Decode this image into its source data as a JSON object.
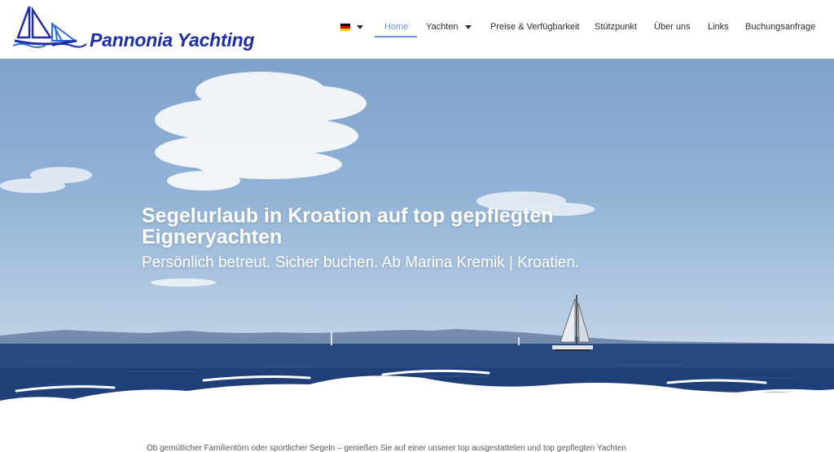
{
  "brand": {
    "name": "Pannonia Yachting",
    "color": "#1c2fa6"
  },
  "nav": {
    "language_icon": "german-flag-icon",
    "items": [
      {
        "label": "Home",
        "active": true
      },
      {
        "label": "Yachten",
        "has_dropdown": true
      },
      {
        "label": "Preise & Verfügbarkeit"
      },
      {
        "label": "Stützpunkt"
      },
      {
        "label": "Über uns"
      },
      {
        "label": "Links"
      },
      {
        "label": "Buchungsanfrage"
      }
    ],
    "active_color": "#6f8fd8"
  },
  "hero": {
    "headline": "Segelurlaub in Kroation auf top gepflegten Eigneryachten",
    "subline": "Persönlich betreut. Sicher buchen. Ab Marina Kremik | Kroatien."
  },
  "content": {
    "intro_text": "Ob gemütlicher Familientörn oder sportlicher Segeln – genießen Sie auf einer unserer top ausgestatteten und top gepflegten Yachten"
  }
}
